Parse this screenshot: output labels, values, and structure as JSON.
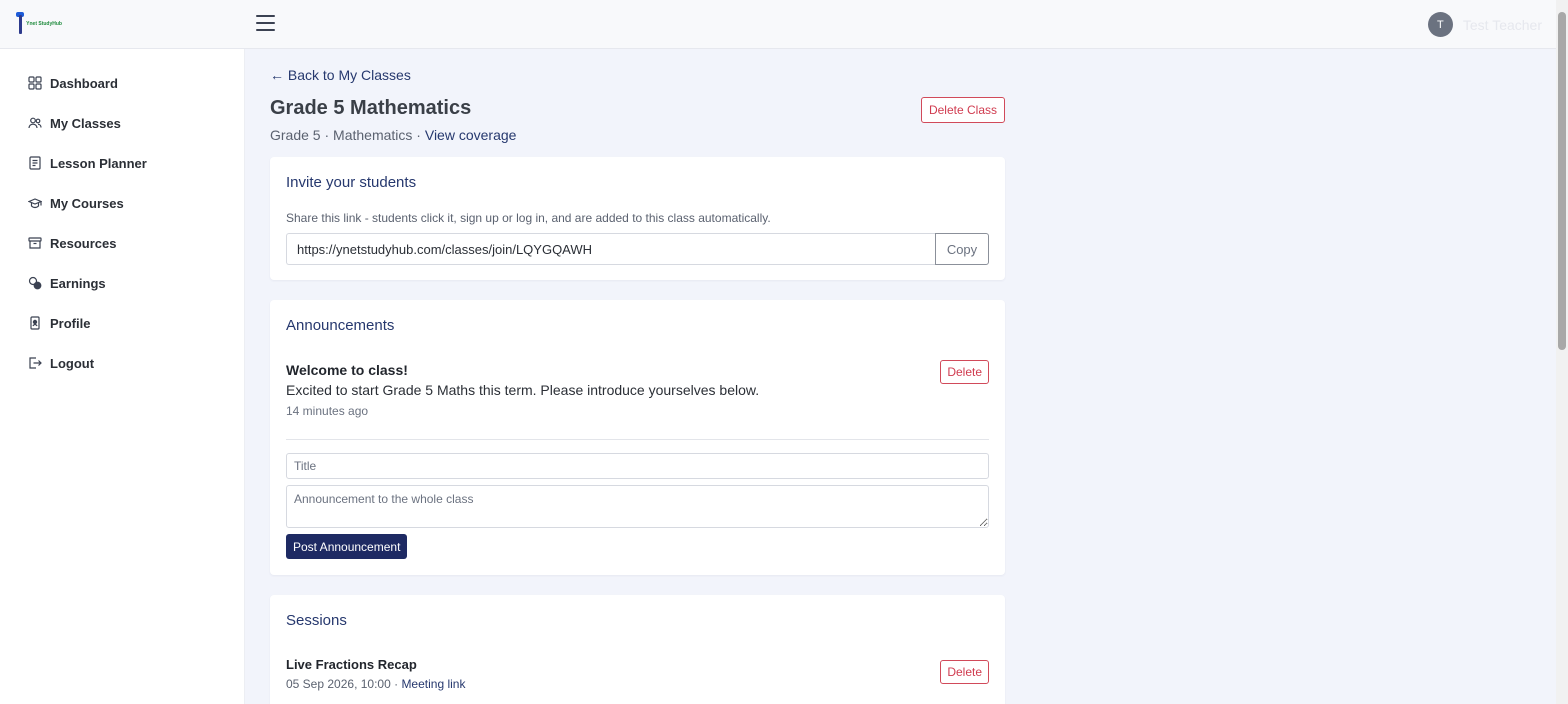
{
  "header": {
    "logo_text": "Ynet StudyHub",
    "user_initial": "T",
    "user_name": "Test Teacher"
  },
  "sidebar": {
    "items": [
      {
        "label": "Dashboard",
        "icon": "dashboard-icon"
      },
      {
        "label": "My Classes",
        "icon": "users-icon"
      },
      {
        "label": "Lesson Planner",
        "icon": "planner-icon"
      },
      {
        "label": "My Courses",
        "icon": "graduation-cap-icon"
      },
      {
        "label": "Resources",
        "icon": "archive-icon"
      },
      {
        "label": "Earnings",
        "icon": "coins-icon"
      },
      {
        "label": "Profile",
        "icon": "id-badge-icon"
      },
      {
        "label": "Logout",
        "icon": "logout-icon"
      }
    ]
  },
  "page": {
    "back_link": "← Back to My Classes",
    "title": "Grade 5 Mathematics",
    "grade": "Grade 5",
    "subject": "Mathematics",
    "separator": " · ",
    "view_coverage": "View coverage",
    "delete_class": "Delete Class"
  },
  "invite": {
    "title": "Invite your students",
    "description": "Share this link - students click it, sign up or log in, and are added to this class automatically.",
    "link": "https://ynetstudyhub.com/classes/join/LQYGQAWH",
    "copy_label": "Copy"
  },
  "announcements": {
    "title": "Announcements",
    "items": [
      {
        "title": "Welcome to class!",
        "body": "Excited to start Grade 5 Maths this term. Please introduce yourselves below.",
        "time": "14 minutes ago",
        "delete_label": "Delete"
      }
    ],
    "title_placeholder": "Title",
    "body_placeholder": "Announcement to the whole class",
    "post_label": "Post Announcement"
  },
  "sessions": {
    "title": "Sessions",
    "items": [
      {
        "title": "Live Fractions Recap",
        "datetime": "05 Sep 2026, 10:00",
        "separator": " · ",
        "meeting_link": "Meeting link",
        "delete_label": "Delete"
      }
    ]
  },
  "colors": {
    "accent": "#26386e",
    "primary_button": "#1e2a63",
    "danger": "#d03b4f",
    "page_background": "#f2f4fb"
  }
}
